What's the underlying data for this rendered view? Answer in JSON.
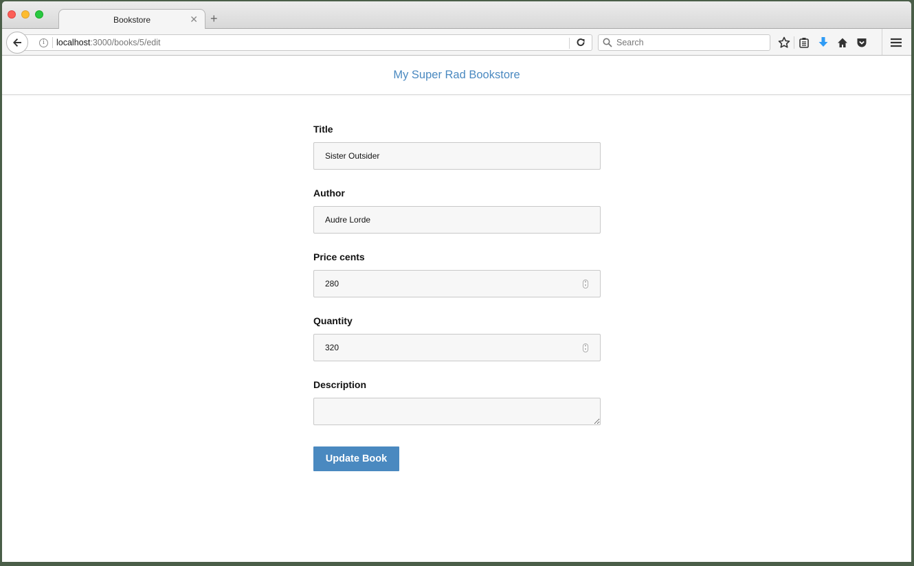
{
  "browser": {
    "tab": {
      "title": "Bookstore"
    },
    "url": {
      "host": "localhost",
      "path": ":3000/books/5/edit"
    },
    "search": {
      "placeholder": "Search"
    },
    "accent_download": "#2f9bf5"
  },
  "page": {
    "site_title": "My Super Rad Bookstore",
    "brand_color": "#4a89c0",
    "form": {
      "title": {
        "label": "Title",
        "value": "Sister Outsider"
      },
      "author": {
        "label": "Author",
        "value": "Audre Lorde"
      },
      "price_cents": {
        "label": "Price cents",
        "value": "280"
      },
      "quantity": {
        "label": "Quantity",
        "value": "320"
      },
      "description": {
        "label": "Description",
        "value": ""
      },
      "submit_label": "Update Book"
    }
  }
}
